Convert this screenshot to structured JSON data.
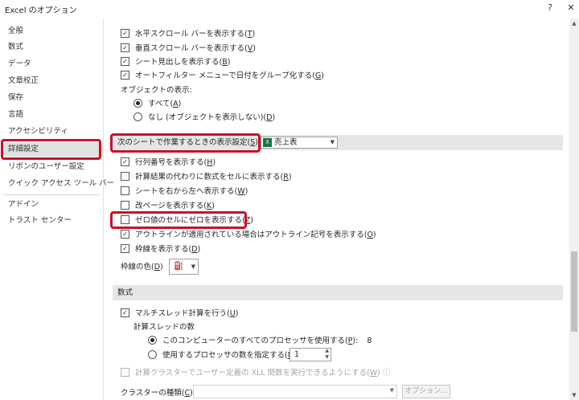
{
  "window": {
    "title": "Excel のオプション",
    "help_icon": "?",
    "close_icon": "✕"
  },
  "sidebar": {
    "items": [
      {
        "label": "全般"
      },
      {
        "label": "数式"
      },
      {
        "label": "データ"
      },
      {
        "label": "文章校正"
      },
      {
        "label": "保存"
      },
      {
        "label": "言語"
      },
      {
        "label": "アクセシビリティ"
      },
      {
        "label": "詳細設定",
        "selected": true
      },
      {
        "label": "リボンのユーザー設定"
      },
      {
        "label": "クイック アクセス ツール バー"
      },
      {
        "label": "アドイン"
      },
      {
        "label": "トラスト センター"
      }
    ]
  },
  "workbook_options": {
    "hscroll": {
      "pre": "水平スクロール バーを表示する(",
      "key": "T",
      "post": ")",
      "checked": true
    },
    "vscroll": {
      "pre": "垂直スクロール バーを表示する(",
      "key": "V",
      "post": ")",
      "checked": true
    },
    "sheet_tabs": {
      "pre": "シート見出しを表示する(",
      "key": "B",
      "post": ")",
      "checked": true
    },
    "group_dates": {
      "pre": "オートフィルター メニューで日付をグループ化する(",
      "key": "G",
      "post": ")",
      "checked": true
    },
    "objects_label": "オブジェクトの表示:",
    "objects_all": {
      "pre": "すべて(",
      "key": "A",
      "post": ")",
      "selected": true
    },
    "objects_none": {
      "pre": "なし (オブジェクトを表示しない)(",
      "key": "D",
      "post": ")",
      "selected": false
    }
  },
  "sheet_options": {
    "header_pre": "次のシートで作業するときの表示設定(",
    "header_key": "S",
    "header_post": "):",
    "sheet_name": "売上表",
    "row_col_headers": {
      "pre": "行列番号を表示する(",
      "key": "H",
      "post": ")",
      "checked": true
    },
    "show_formulas": {
      "pre": "計算結果の代わりに数式をセルに表示する(",
      "key": "R",
      "post": ")",
      "checked": false
    },
    "right_to_left": {
      "pre": "シートを右から左へ表示する(",
      "key": "W",
      "post": ")",
      "checked": false
    },
    "page_breaks": {
      "pre": "改ページを表示する(",
      "key": "K",
      "post": ")",
      "checked": false
    },
    "zero_values": {
      "pre": "ゼロ値のセルにゼロを表示する(",
      "key": "Z",
      "post": ")",
      "checked": false
    },
    "outline_symbols": {
      "pre": "アウトラインが適用されている場合はアウトライン記号を表示する(",
      "key": "O",
      "post": ")",
      "checked": true
    },
    "gridlines": {
      "pre": "枠線を表示する(",
      "key": "D",
      "post": ")",
      "checked": true
    },
    "gridline_color_pre": "枠線の色(",
    "gridline_color_key": "D",
    "gridline_color_post": ")"
  },
  "formulas": {
    "header": "数式",
    "multithread": {
      "pre": "マルチスレッド計算を行う(",
      "key": "U",
      "post": ")",
      "checked": true
    },
    "threads_label": "計算スレッドの数",
    "all_processors": {
      "pre": "このコンピューターのすべてのプロセッサを使用する(",
      "key": "P",
      "post": "):",
      "value": "8",
      "selected": true
    },
    "manual": {
      "pre": "使用するプロセッサの数を指定する(",
      "key": "M",
      "post": "):",
      "value": "1",
      "selected": false
    },
    "xll_cluster": {
      "pre": "計算クラスターでユーザー定義の XLL 関数を実行できるようにする(",
      "key": "W",
      "post": ")",
      "info_icon": "ⓘ",
      "checked": false
    },
    "cluster_type_pre": "クラスターの種類(",
    "cluster_type_key": "C",
    "cluster_type_post": "):",
    "options_button": "オプション..."
  },
  "colors": {
    "highlight": "#c8112b",
    "selected_bg": "#e1e1e1",
    "section_bg": "#e6e6e6"
  }
}
